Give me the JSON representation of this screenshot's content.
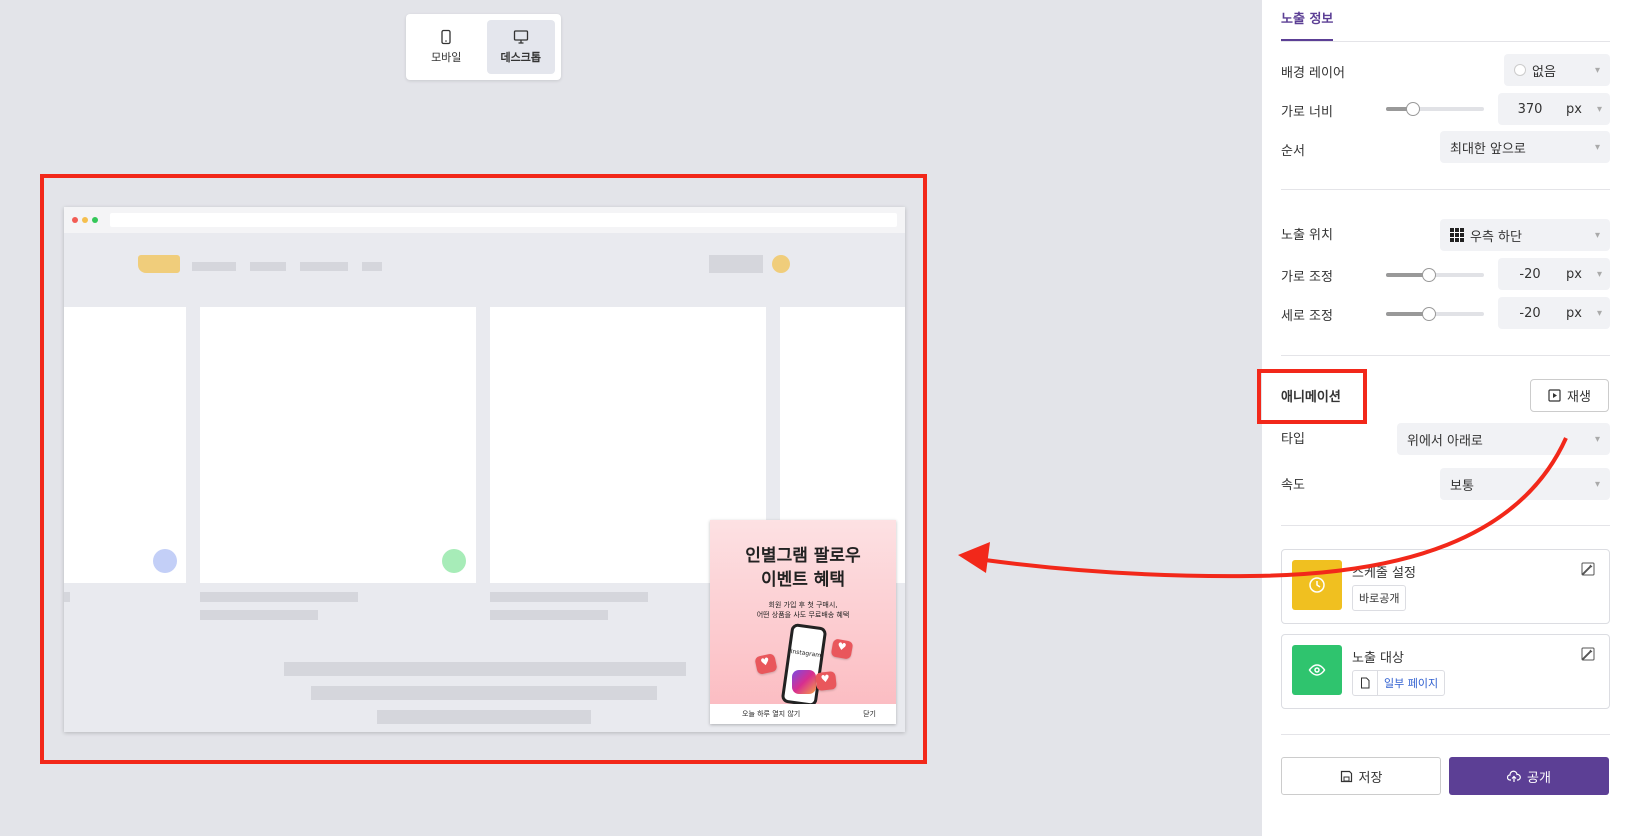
{
  "device_toggle": {
    "mobile_label": "모바일",
    "desktop_label": "데스크톱",
    "active": "desktop"
  },
  "preview": {
    "popup": {
      "title": "인별그램 팔로우\n이벤트 혜택",
      "subtitle": "회원 가입 후 첫 구매시,\n어떤 상품을 사도 무료배송 혜택",
      "phone_text": "Instagram",
      "hide_today_label": "오늘 하루 열지 않기",
      "close_label": "닫기"
    }
  },
  "panel": {
    "tab_label": "노출 정보",
    "background_layer": {
      "label": "배경 레이어",
      "value": "없음"
    },
    "width": {
      "label": "가로 너비",
      "value": "370",
      "unit": "px",
      "slider_fraction": 0.28
    },
    "order": {
      "label": "순서",
      "value": "최대한 앞으로"
    },
    "position": {
      "label": "노출 위치",
      "value": "우측 하단"
    },
    "x_offset": {
      "label": "가로 조정",
      "value": "-20",
      "unit": "px",
      "slider_fraction": 0.44
    },
    "y_offset": {
      "label": "세로 조정",
      "value": "-20",
      "unit": "px",
      "slider_fraction": 0.44
    },
    "animation": {
      "title": "애니메이션",
      "play_label": "재생",
      "type_label": "타입",
      "type_value": "위에서 아래로",
      "speed_label": "속도",
      "speed_value": "보통"
    },
    "schedule": {
      "title": "스케줄 설정",
      "chip": "바로공개",
      "icon": "clock-icon",
      "color": "#f0c020"
    },
    "target": {
      "title": "노출 대상",
      "chip": "일부 페이지",
      "icon": "eye-icon",
      "color": "#2fc46e"
    },
    "save_label": "저장",
    "publish_label": "공개"
  },
  "colors": {
    "accent": "#5c3f95",
    "highlight": "#f2281a"
  }
}
